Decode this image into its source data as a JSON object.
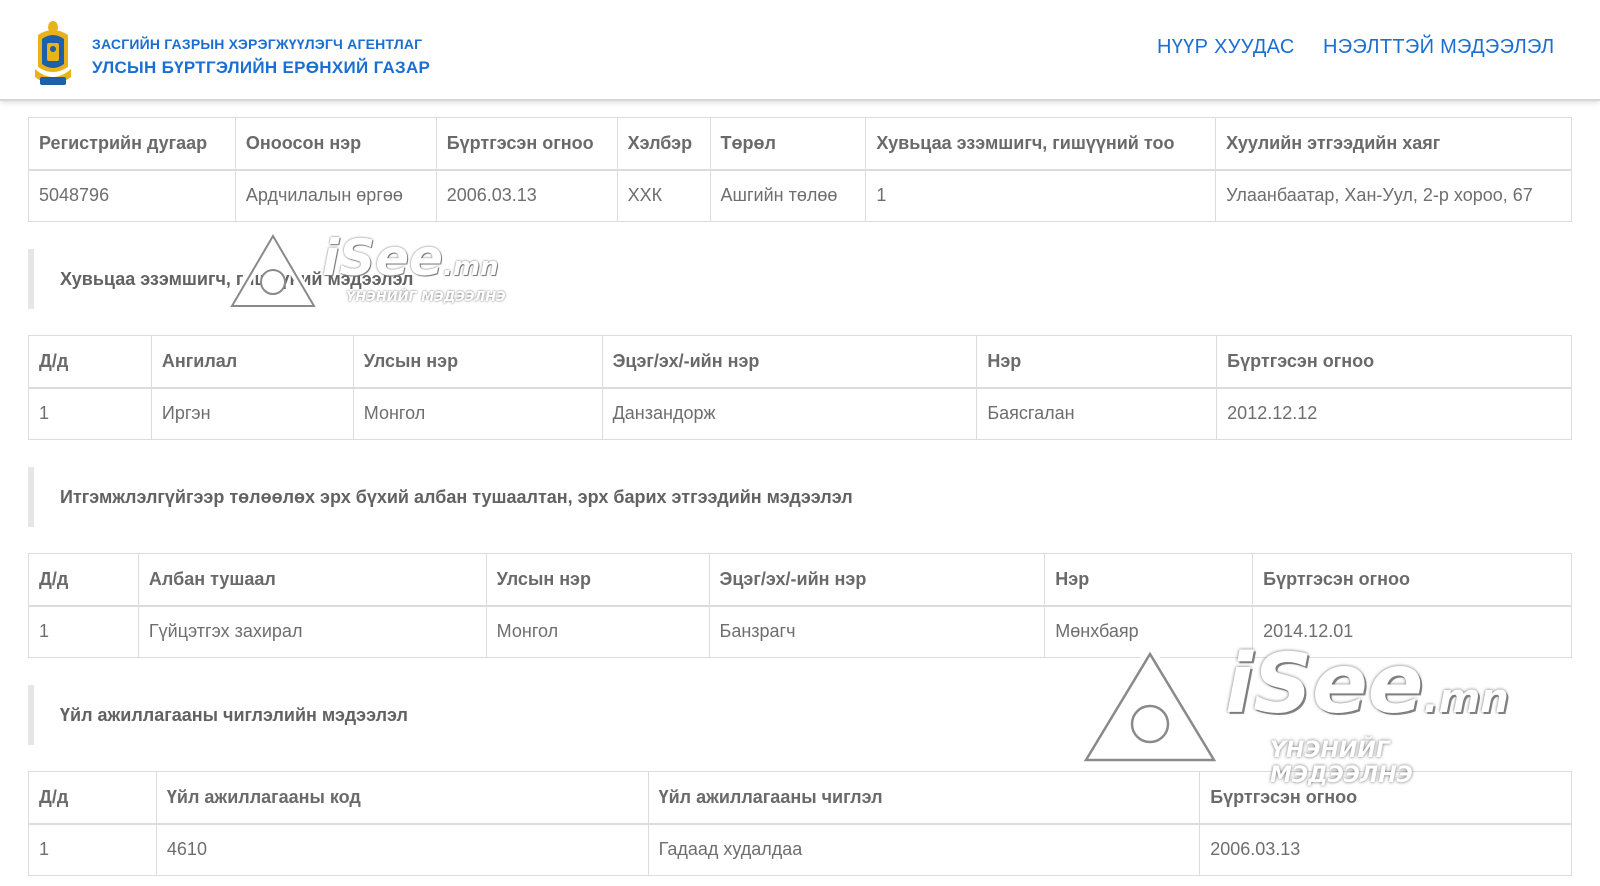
{
  "header": {
    "agency_line1": "ЗАСГИЙН ГАЗРЫН ХЭРЭГЖҮҮЛЭГЧ АГЕНТЛАГ",
    "agency_line2": "УЛСЫН БҮРТГЭЛИЙН ЕРӨНХИЙ ГАЗАР",
    "nav_home": "НҮҮР ХУУДАС",
    "nav_open_data": "НЭЭЛТТЭЙ МЭДЭЭЛЭЛ"
  },
  "company": {
    "headers": [
      "Регистрийн дугаар",
      "Оноосон нэр",
      "Бүртгэсэн огноо",
      "Хэлбэр",
      "Төрөл",
      "Хувьцаа эзэмшигч, гишүүний тоо",
      "Хуулийн этгээдийн хаяг"
    ],
    "row": [
      "5048796",
      "Ардчилалын өргөө",
      "2006.03.13",
      "ХХК",
      "Ашгийн төлөө",
      "1",
      "Улаанбаатар, Хан-Уул, 2-р хороо, 67"
    ]
  },
  "shareholders": {
    "title": "Хувьцаа эзэмшигч, гишүүний мэдээлэл",
    "headers": [
      "Д/д",
      "Ангилал",
      "Улсын нэр",
      "Эцэг/эх/-ийн нэр",
      "Нэр",
      "Бүртгэсэн огноо"
    ],
    "row": [
      "1",
      "Иргэн",
      "Монгол",
      "Данзандорж",
      "Баясгалан",
      "2012.12.12"
    ]
  },
  "officials": {
    "title": "Итгэмжлэлгүйгээр төлөөлөх эрх бүхий албан тушаалтан, эрх барих этгээдийн мэдээлэл",
    "headers": [
      "Д/д",
      "Албан тушаал",
      "Улсын нэр",
      "Эцэг/эх/-ийн нэр",
      "Нэр",
      "Бүртгэсэн огноо"
    ],
    "row": [
      "1",
      "Гүйцэтгэх захирал",
      "Монгол",
      "Банзрагч",
      "Мөнхбаяр",
      "2014.12.01"
    ]
  },
  "activity": {
    "title": "Үйл ажиллагааны чиглэлийн мэдээлэл",
    "headers": [
      "Д/д",
      "Үйл ажиллагааны код",
      "Үйл ажиллагааны чиглэл",
      "Бүртгэсэн огноо"
    ],
    "row": [
      "1",
      "4610",
      "Гадаад худалдаа",
      "2006.03.13"
    ]
  },
  "watermark": {
    "brand": "iSee",
    "domain": ".mn",
    "tagline": "ҮНЭНИЙГ МЭДЭЭЛНЭ"
  },
  "colors": {
    "brand_blue": "#1c6fd0",
    "logo_gold": "#e8b21a",
    "logo_blue": "#1d5fa8"
  }
}
